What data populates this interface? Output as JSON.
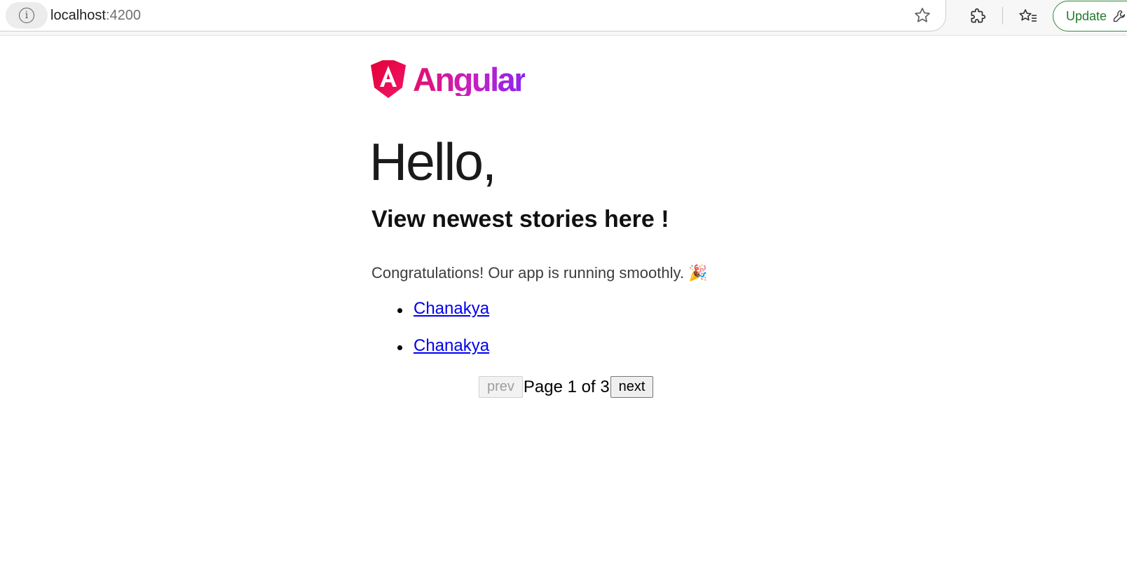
{
  "browser": {
    "url_host": "localhost",
    "url_port": ":4200",
    "update_label": "Update"
  },
  "brand": {
    "logo_text": "Angular",
    "colors": {
      "red": "#dd0031",
      "pink": "#e40f6b",
      "purple": "#8b24f0"
    }
  },
  "page": {
    "greeting": "Hello,",
    "subheading": "View newest stories here !",
    "message": "Congratulations! Our app is running smoothly.",
    "message_emoji": "🎉",
    "stories": [
      {
        "label": "Chanakya"
      },
      {
        "label": "Chanakya"
      }
    ]
  },
  "pagination": {
    "prev_label": "prev",
    "page_text": "Page 1 of 3",
    "next_label": "next",
    "current_page": 1,
    "total_pages": 3,
    "prev_disabled": true
  },
  "icons": [
    "info-icon",
    "star-icon",
    "extensions-icon",
    "favorites-icon",
    "wrench-icon",
    "angular-logo-icon",
    "party-popper-icon"
  ]
}
